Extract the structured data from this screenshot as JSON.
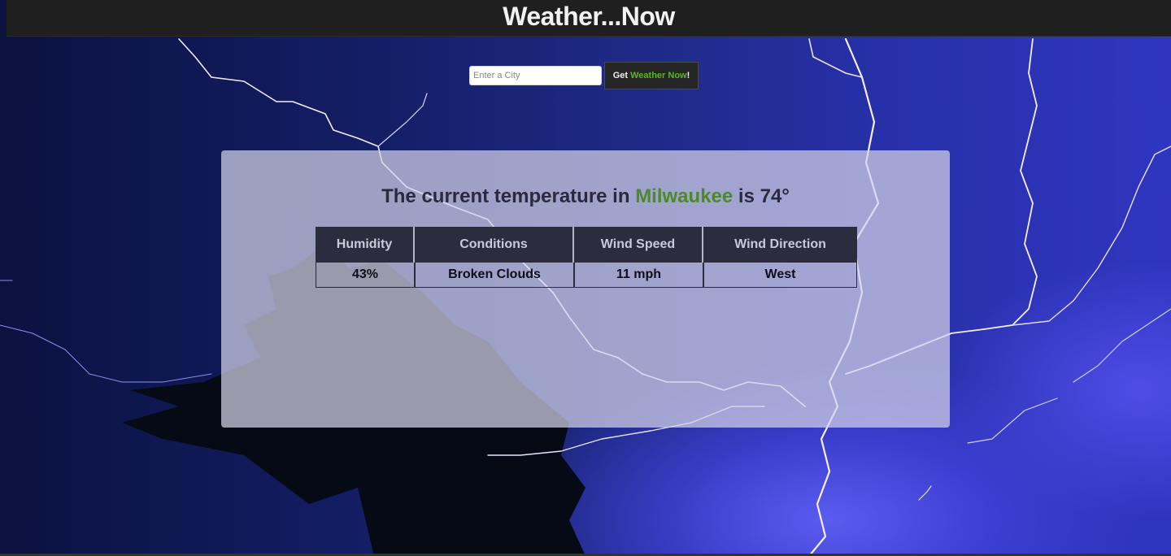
{
  "header": {
    "title": "Weather...Now"
  },
  "search": {
    "placeholder": "Enter a City",
    "value": "",
    "button_prefix": "Get ",
    "button_accent": "Weather Now",
    "button_suffix": "!"
  },
  "panel": {
    "heading_prefix": "The current temperature in ",
    "city": "Milwaukee",
    "heading_middle": " is ",
    "temperature": "74°"
  },
  "stats": {
    "headers": [
      "Humidity",
      "Conditions",
      "Wind Speed",
      "Wind Direction"
    ],
    "values": [
      "43%",
      "Broken Clouds",
      "11 mph",
      "West"
    ]
  },
  "colors": {
    "header_bg": "#1f1f1f",
    "accent_green": "#56b81e",
    "city_green": "#4b8a27",
    "table_header_bg": "#2b2d3e"
  }
}
